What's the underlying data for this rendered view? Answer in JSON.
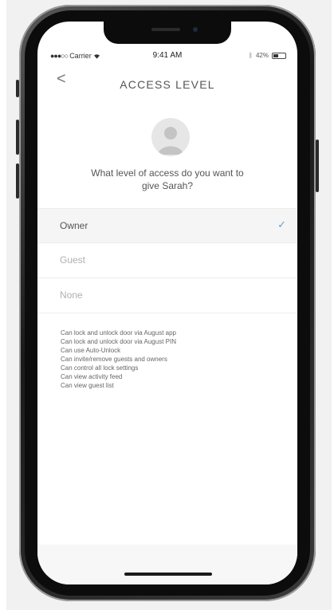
{
  "status_bar": {
    "carrier": "Carrier",
    "time": "9:41 AM",
    "battery": "42%",
    "battery_level": 0.42
  },
  "header": {
    "back_icon": "chevron-left-icon",
    "back_glyph": "<",
    "title": "ACCESS LEVEL"
  },
  "prompt": {
    "question": "What level of access do you want to give Sarah?"
  },
  "access_levels": [
    {
      "label": "Owner",
      "selected": true
    },
    {
      "label": "Guest",
      "selected": false
    },
    {
      "label": "None",
      "selected": false
    }
  ],
  "checkmark_glyph": "✓",
  "permissions": [
    "Can lock and unlock door via August app",
    "Can lock and unlock door via August PIN",
    "Can use Auto-Unlock",
    "Can invite/remove guests and owners",
    "Can control all lock settings",
    "Can view activity feed",
    "Can view guest list"
  ],
  "colors": {
    "accent": "#5aa3d8",
    "phone_frame": "#0c0c0c"
  }
}
